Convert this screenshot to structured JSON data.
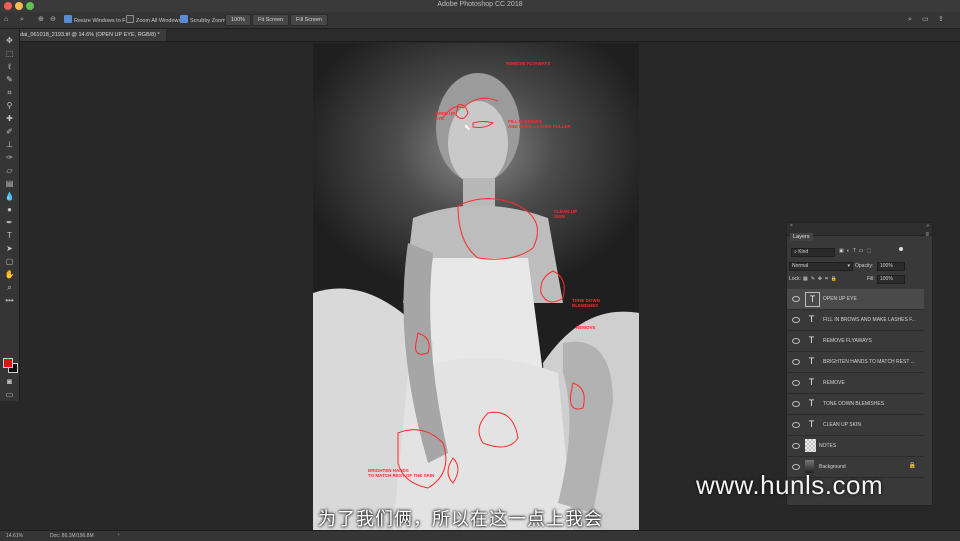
{
  "window": {
    "title": "Adobe Photoshop CC 2018",
    "traffic_lights": [
      "#ee5f57",
      "#f5bd4f",
      "#5fc350"
    ]
  },
  "options_bar": {
    "resize_windows_label": "Resize Windows to Fit",
    "zoom_all_label": "Zoom All Windows",
    "scrubby_zoom_label": "Scrubby Zoom",
    "zoom_value": "100%",
    "fit_screen_label": "Fit Screen",
    "fill_screen_label": "Fill Screen"
  },
  "document": {
    "tab_label": "dai_061018_2193.tif @ 14.6% (OPEN UP EYE, RGB/8) *"
  },
  "tools": [
    "move-tool-icon",
    "marquee-tool-icon",
    "lasso-tool-icon",
    "quick-select-tool-icon",
    "crop-tool-icon",
    "eyedropper-tool-icon",
    "healing-brush-tool-icon",
    "brush-tool-icon",
    "clone-stamp-tool-icon",
    "history-brush-tool-icon",
    "eraser-tool-icon",
    "gradient-tool-icon",
    "blur-tool-icon",
    "dodge-tool-icon",
    "pen-tool-icon",
    "type-tool-icon",
    "path-select-tool-icon",
    "shape-tool-icon",
    "hand-tool-icon",
    "zoom-tool-icon",
    "more-tools-icon"
  ],
  "colors": {
    "foreground": "#e01010",
    "background": "#111111",
    "accent": "#ff2a2a"
  },
  "annotations": {
    "remove_flyaways": "REMOVE FLYAWAYS",
    "open_up_eye": "OPEN UP\nEYE",
    "fill_in_brows": "FILL IN BROWS\nAND MAKE LASHES FULLER",
    "clean_up_skin": "CLEAN UP\nSKIN",
    "tone_down": "TONE DOWN\nBLEMISHES",
    "remove": "REMOVE",
    "brighten_hands": "BRIGHTEN HANDS\nTO MATCH REST OF THE SKIN"
  },
  "status_bar": {
    "zoom": "14.61%",
    "doc": "Doc: 86.1M/196.8M"
  },
  "layers_panel": {
    "tab_label": "Layers",
    "kind_label": "Kind",
    "blend_mode": "Normal",
    "opacity_label": "Opacity:",
    "opacity_value": "100%",
    "lock_label": "Lock:",
    "fill_label": "Fill:",
    "fill_value": "100%",
    "layers": [
      {
        "name": "OPEN UP EYE",
        "kind": "text",
        "selected": true
      },
      {
        "name": "FILL IN BROWS AND MAKE LASHES F...",
        "kind": "text",
        "selected": false
      },
      {
        "name": "REMOVE FLYAWAYS",
        "kind": "text",
        "selected": false
      },
      {
        "name": "BRIGHTEN HANDS TO MATCH REST ...",
        "kind": "text",
        "selected": false
      },
      {
        "name": "REMOVE",
        "kind": "text",
        "selected": false
      },
      {
        "name": "TONE DOWN BLEMISHES",
        "kind": "text",
        "selected": false
      },
      {
        "name": "CLEAN UP  SKIN",
        "kind": "text",
        "selected": false
      },
      {
        "name": "NOTES",
        "kind": "raster",
        "selected": false
      },
      {
        "name": "Background",
        "kind": "image",
        "selected": false
      }
    ]
  },
  "overlay": {
    "subtitle": "为了我们俩，所以在这一点上我会",
    "watermark": "www.hunls.com"
  }
}
